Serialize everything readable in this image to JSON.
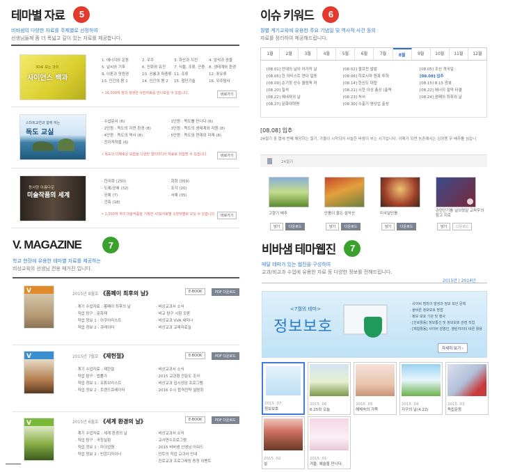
{
  "s5": {
    "title": "테마별 자료",
    "badge": "5",
    "sub1": "비바샘의 다양한 자료를 주제별로 선정하여",
    "sub2": "선생님들께 좀 더 폭넓고 깊이 있는 자료를 제공합니다.",
    "rows": [
      {
        "thumb_line1": "3D로 보는 과학",
        "thumb_line2": "사이언스 백과",
        "col1": [
          "1. 에너지와 운동",
          "5. 날씨와 기후",
          "9. 이론과 망원경",
          "13. 인간의 몸 1"
        ],
        "col2": [
          "2. 우주",
          "6. 진화와 유전",
          "10. 공룡과 파충류",
          "14. 인간의 몸 2"
        ],
        "col3": [
          "3. 화산과 지진",
          "7. 식물, 조류, 곤충",
          "11. 조류",
          "15. 첨단기술"
        ],
        "col4": [
          "4. 암석과 광물",
          "8. 생태계와 환경",
          "12. 포유류",
          "16. 우주탐사"
        ],
        "note": "• 16,000여 장의 생생한 사진자료를 만나보실 수 있습니다.",
        "btn": "바로가기"
      },
      {
        "thumb_line1": "스마트교연과 함께 하는",
        "thumb_line2": "독도 교실",
        "col1": [
          "· 수업문서 (6)",
          "· 2단원 : 독도의 자연 환경 (8)",
          "· 4단원 : 독도의 역사 (8)",
          "· 전자저작물 (6)"
        ],
        "col2": [
          "· 1단원 : 독도를 만나다 (6)",
          "· 3단원 : 독도의 생태계와 자원 (8)",
          "· 5단원 : 독도와 현재와 미래 (8)"
        ],
        "note": "• 독도의 다채로운 모습을 다양한 멀티미디어 자료로 학습할 수 있습니다.",
        "btn": "바로가기"
      },
      {
        "thumb_line1": "동서양 아름다운",
        "thumb_line2": "미술작품의 세계",
        "col1": [
          "· 한국화 (250)",
          "· 도예/공예 (32)",
          "· 공예 (7)",
          "· 건축 (18)"
        ],
        "col2": [
          "· 회화 (359)",
          "· 조각 (20)",
          "· 서예 (35)"
        ],
        "note": "• 1,000여 개의 미술작품을 기획전 시대/서로별 소장처별로 보실 수 있습니다.",
        "btn": "바로가기"
      }
    ]
  },
  "s6": {
    "title": "이슈 키워드",
    "badge": "6",
    "sub1": "월별 계기교육에 유용한 주요 기념일 및 역사적 사건 등의",
    "sub2": "자료를 정리하여 제공해드립니다.",
    "months": [
      "1월",
      "2월",
      "3월",
      "4월",
      "5월",
      "6월",
      "7월",
      "8월",
      "9월",
      "10월",
      "11월",
      "12월"
    ],
    "active": "8월",
    "colA": [
      "[08.01] 안데의 날이 아가작 날",
      "[08.05] 한 아티스트 연다 일동",
      "[08.09] 순기정 선수 올림픽 마",
      "[08.20] 칠석",
      "[08.22] 예네자의 날",
      "[08.27] 문화대혁명"
    ],
    "colB": [
      "[08.02] 결프전 발발",
      "[08.06] 히로시마 원폭 투하",
      "[08.14] 한신도 대첩",
      "[08.21] 시한 이상 총상 (출력",
      "[08.23] 처서",
      "[08.30] 수출기 영상업 출성"
    ],
    "colC": [
      "[08.05] 조선 개국일",
      "[08.08] 입추",
      "[08.15] 8.15 광복",
      "[08.22] 에너지 절약 타결",
      "[08.24] 꽁폐의 최후의 날"
    ],
    "detail_title": "[08.08] 입추",
    "detail_text": "24절기 중 열세 번째 해당하는 절기. 가을이 시작되어 서늘한 바람이 부는 시기입니다. 이때가 되면 농촌에서는 김장용 무 배추를 심습니",
    "tag": "24절기",
    "photos": [
      "고향기 배추",
      "단풍이 물든 설악산",
      "미국달단풍",
      "관련단기를 널브렸달 교차우의 참고 지로"
    ],
    "btn_a": "담기",
    "btn_b": "다운로드"
  },
  "s7a": {
    "title": "V. MAGAZINE",
    "badge": "7",
    "sub1": "학교 현장에 유용한 테마별 자료를 제공하는",
    "sub2": "비상교육의 선생님 전용 매거진 입니다.",
    "btn_ebook": "E-BOOK",
    "btn_pdf": "PDF 다운로드",
    "issues": [
      {
        "month": "2015년 8월호",
        "name": "《폼페이 최후의 날》",
        "lines": [
          "· 계기 수업자료 : 폼페이 최후의 날",
          "· 직업 탐구 : 문화재",
          "· 직업 정보 1 : 아쿠아리스트",
          "· 직업 정보 2 : 큐레이터"
        ],
        "right": [
          "· 비상교과서 소식",
          "· 비교 탐구 시험 모론",
          "· 비상교과 VVA 세미나",
          "· 비상교과 교재자료실"
        ]
      },
      {
        "month": "2015년 7월호",
        "name": "《제헌절》",
        "lines": [
          "· 계기 수업자료 : 제헌절",
          "· 직업 탐구 : 법률가",
          "· 직업 정보 1 : 유튜브리스트",
          "· 직업 정보 2 : 트렌드큐레이터"
        ],
        "right": [
          "· 비상교과서 소식",
          "· 2015 교과형 전문도 조사",
          "· 비상교과 입시상담 프로그램",
          "· 2016 수시 합격전략 설명회"
        ]
      },
      {
        "month": "2015년 6월호",
        "name": "《세계 환경의 날》",
        "lines": [
          "· 계기 수업자료 : 세계 환경의 날",
          "· 직업 탐구 : 곡칭실험",
          "· 직업 정보 1 : 마크업원",
          "· 직업 정보 2 : 빈콘디자이너"
        ],
        "right": [
          "· 비상교과서 소식",
          "· 교사연수프로그램",
          "· 2015 비바샘 선생님 어워드",
          "· 인트의 직업 교과서 안내",
          "· 진로교과 프로그래밍 증정 이벤트"
        ]
      }
    ]
  },
  "s7b": {
    "title": "비바샘 테마웹진",
    "badge": "7",
    "sub1": "매달 테마가 있는 웹진을 구성하여",
    "sub2": "교과/비교과 수업에 유용한 자료 등 다양한 정보를 전해드립니다.",
    "years": "2015년 | 2014년",
    "banner_small": "<7월의 테마>",
    "banner_big": "정보보호",
    "banner_list": [
      "· 사이버 범죄의 발생과 정보 보안 문제",
      "· 올바른 정보보호 방법",
      "· 정보 보호 기관 및 행사",
      "· [진로활동] 정보통신 및 정보보호 관련 직업",
      "· [체험활동] 사이버 감염인, 챌린지이터 바른 활용"
    ],
    "banner_btn": "자세히 보기 ›",
    "tiles": [
      {
        "date": "2015 .07",
        "name": "정보보호"
      },
      {
        "date": "2015 .06",
        "name": "6.25와 오늘"
      },
      {
        "date": "2015 .05",
        "name": "해체속의 가족"
      },
      {
        "date": "2015 .04",
        "name": "지구의 날(4.22)"
      },
      {
        "date": "2015 .03",
        "name": "독립운동"
      },
      {
        "date": "2015 .02",
        "name": "설"
      },
      {
        "date": "2015 .01",
        "name": "겨울, 예술을 만나다."
      }
    ]
  },
  "colors": {
    "red": "#e23a2e",
    "green": "#3aa12f",
    "blue": "#2e6fd0"
  }
}
